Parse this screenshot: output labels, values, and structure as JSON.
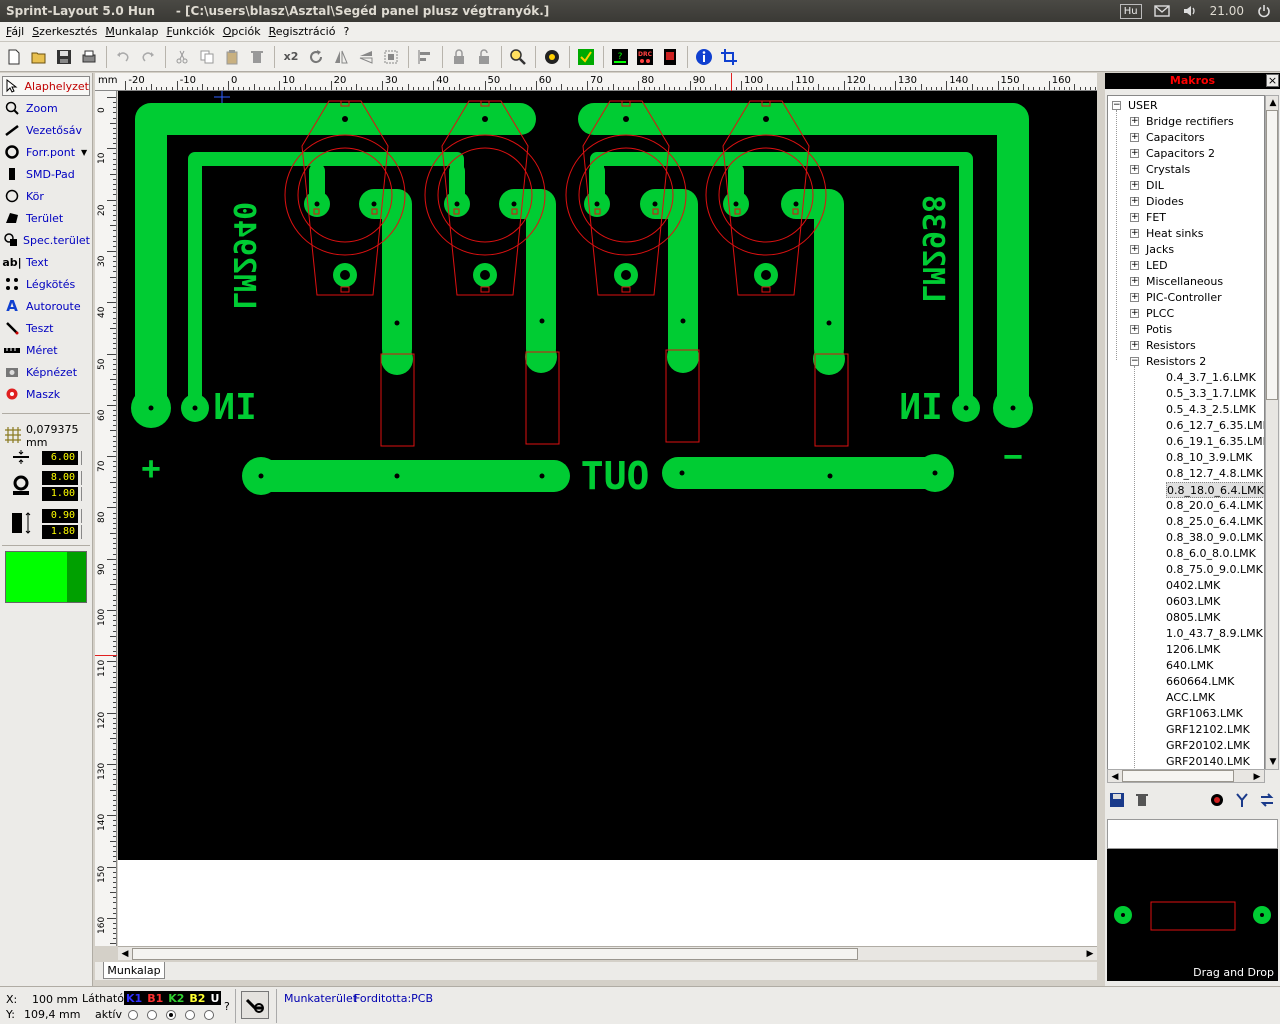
{
  "window": {
    "title": "Sprint-Layout 5.0 Hun     - [C:\\users\\blasz\\Asztal\\Segéd panel plusz végtranyók.]",
    "indicators": {
      "lang": "Hu",
      "clock": "21.00"
    }
  },
  "menu": [
    "Fájl",
    "Szerkesztés",
    "Munkalap",
    "Funkciók",
    "Opciók",
    "Regisztráció",
    "?"
  ],
  "toolbar": {
    "x2_label": "x2"
  },
  "tools": [
    {
      "label": "Alaphelyzet",
      "icon": "pointer-icon"
    },
    {
      "label": "Zoom",
      "icon": "zoom-icon"
    },
    {
      "label": "Vezetősáv",
      "icon": "track-icon"
    },
    {
      "label": "Forr.pont",
      "icon": "pad-icon"
    },
    {
      "label": "SMD-Pad",
      "icon": "smd-pad-icon"
    },
    {
      "label": "Kör",
      "icon": "circle-icon"
    },
    {
      "label": "Terület",
      "icon": "area-icon"
    },
    {
      "label": "Spec.terület",
      "icon": "special-area-icon"
    },
    {
      "label": "Text",
      "icon": "text-icon"
    },
    {
      "label": "Légkötés",
      "icon": "airwire-icon"
    },
    {
      "label": "Autoroute",
      "icon": "autoroute-icon"
    },
    {
      "label": "Teszt",
      "icon": "test-icon"
    },
    {
      "label": "Méret",
      "icon": "measure-icon"
    },
    {
      "label": "Képnézet",
      "icon": "photoview-icon"
    },
    {
      "label": "Maszk",
      "icon": "mask-icon"
    }
  ],
  "grid": {
    "value": "0,079375 mm"
  },
  "track_width": "6.00",
  "pad_outer": "8.00",
  "pad_inner": "1.00",
  "smd_w": "0.90",
  "smd_h": "1.80",
  "active_color": "#00ff00",
  "ruler": {
    "unit": "mm",
    "h_labels": [
      "-20",
      "-10",
      "0",
      "10",
      "20",
      "30",
      "40",
      "50",
      "60",
      "70",
      "80",
      "90",
      "100",
      "110",
      "120",
      "130",
      "140",
      "150",
      "160"
    ],
    "v_labels": [
      "0",
      "10",
      "20",
      "30",
      "40",
      "50",
      "60",
      "70",
      "80",
      "90",
      "100",
      "110",
      "120",
      "130",
      "140",
      "150",
      "160"
    ]
  },
  "pcb": {
    "text_out": "OUT",
    "text_in_left": "IN",
    "text_in_right": "IN",
    "text_lm_left": "LM2940",
    "text_lm_right": "LM2938",
    "text_plus": "+",
    "text_minus": "−",
    "board_color": "#000000",
    "copper_color": "#00cc33",
    "outline_color": "#dd1111"
  },
  "sheet_tab": "Munkalap",
  "status": {
    "x_label": "X:",
    "x_value": "100 mm",
    "y_label": "Y:",
    "y_value": "109,4 mm",
    "visible_label": "Látható",
    "active_label": "aktív",
    "layers": [
      {
        "name": "K1",
        "color": "#3030ff"
      },
      {
        "name": "B1",
        "color": "#ff3030"
      },
      {
        "name": "K2",
        "color": "#30d030"
      },
      {
        "name": "B2",
        "color": "#ffff30"
      },
      {
        "name": "U",
        "color": "#ffffff"
      }
    ],
    "question": "?",
    "workspace": "Munkaterület",
    "fordit": "Forditotta:PCB"
  },
  "macros": {
    "title": "Makros",
    "close": "×",
    "root": "USER",
    "folders": [
      "Bridge rectifiers",
      "Capacitors",
      "Capacitors 2",
      "Crystals",
      "DIL",
      "Diodes",
      "FET",
      "Heat sinks",
      "Jacks",
      "LED",
      "Miscellaneous",
      "PIC-Controller",
      "PLCC",
      "Potis",
      "Resistors",
      "Resistors 2"
    ],
    "files": [
      "0.4_3.7_1.6.LMK",
      "0.5_3.3_1.7.LMK",
      "0.5_4.3_2.5.LMK",
      "0.6_12.7_6.35.LMK",
      "0.6_19.1_6.35.LMK",
      "0.8_10_3.9.LMK",
      "0.8_12.7_4.8.LMK",
      "0.8_18.0_6.4.LMK",
      "0.8_20.0_6.4.LMK",
      "0.8_25.0_6.4.LMK",
      "0.8_38.0_9.0.LMK",
      "0.8_6.0_8.0.LMK",
      "0.8_75.0_9.0.LMK",
      "0402.LMK",
      "0603.LMK",
      "0805.LMK",
      "1.0_43.7_8.9.LMK",
      "1206.LMK",
      "640.LMK",
      "660664.LMK",
      "ACC.LMK",
      "GRF1063.LMK",
      "GRF12102.LMK",
      "GRF20102.LMK",
      "GRF20140.LMK"
    ],
    "selected": "0.8_18.0_6.4.LMK",
    "drag_drop": "Drag and Drop"
  }
}
